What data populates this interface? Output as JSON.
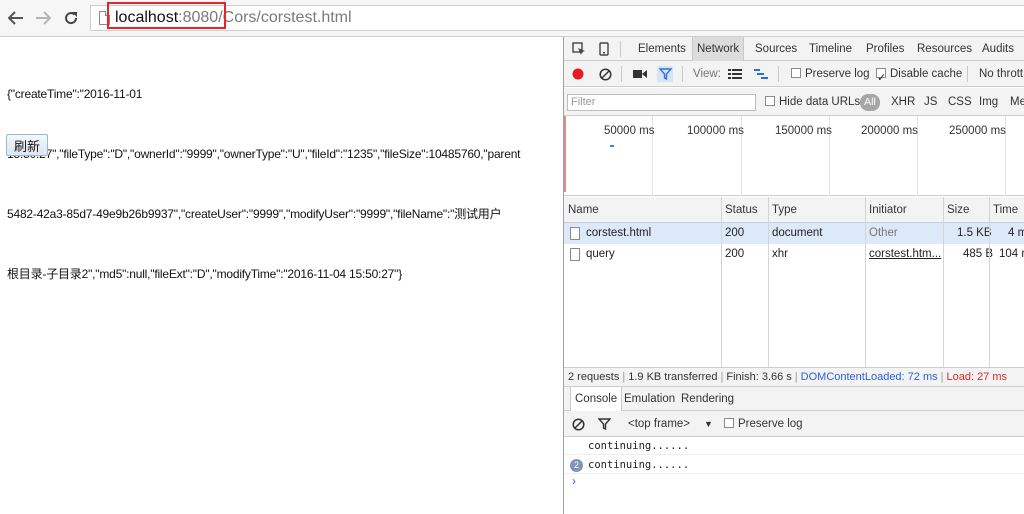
{
  "browser": {
    "url_host": "localhost",
    "url_port": ":8080",
    "url_path": "/Cors/corstest.html",
    "icons": [
      "back-arrow-icon",
      "forward-arrow-icon",
      "reload-icon",
      "page-icon"
    ]
  },
  "page": {
    "json_lines": [
      "{\"createTime\":\"2016-11-01",
      "15:50:27\",\"fileType\":\"D\",\"ownerId\":\"9999\",\"ownerType\":\"U\",\"fileId\":\"1235\",\"fileSize\":10485760,\"parent",
      "5482-42a3-85d7-49e9b26b9937\",\"createUser\":\"9999\",\"modifyUser\":\"9999\",\"fileName\":\"测试用户",
      "根目录-子目录2\",\"md5\":null,\"fileExt\":\"D\",\"modifyTime\":\"2016-11-04 15:50:27\"}"
    ],
    "refresh_label": "刷新"
  },
  "devtools": {
    "tabs": [
      "Elements",
      "Network",
      "Sources",
      "Timeline",
      "Profiles",
      "Resources",
      "Audits"
    ],
    "active_tab": "Network",
    "toolbar": {
      "view_label": "View:",
      "preserve_log": "Preserve log",
      "disable_cache": "Disable cache",
      "throttle": "No thrott"
    },
    "filter": {
      "placeholder": "Filter",
      "hide_data_urls": "Hide data URLs",
      "types": [
        "All",
        "XHR",
        "JS",
        "CSS",
        "Img",
        "Me"
      ]
    },
    "timeline_labels": [
      "50000 ms",
      "100000 ms",
      "150000 ms",
      "200000 ms",
      "250000 ms"
    ],
    "columns": [
      "Name",
      "Status",
      "Type",
      "Initiator",
      "Size",
      "Time"
    ],
    "requests": [
      {
        "name": "corstest.html",
        "status": "200",
        "type": "document",
        "initiator": "Other",
        "size": "1.5 KB",
        "time": "4 m"
      },
      {
        "name": "query",
        "status": "200",
        "type": "xhr",
        "initiator": "corstest.htm...",
        "size": "485 B",
        "time": "104 m"
      }
    ],
    "summary": {
      "requests": "2 requests",
      "transferred": "1.9 KB transferred",
      "finish": "Finish: 3.66 s",
      "dom_content_loaded": "DOMContentLoaded: 72 ms",
      "load": "Load: 27 ms"
    },
    "drawer_tabs": [
      "Console",
      "Emulation",
      "Rendering"
    ],
    "console": {
      "frame": "<top frame>",
      "preserve_log": "Preserve log",
      "messages": [
        {
          "text": "continuing......",
          "count": ""
        },
        {
          "text": "continuing......",
          "count": "2"
        }
      ],
      "prompt": "›"
    },
    "colors": {
      "dom_content_loaded": "#2b60d6",
      "load": "#d62b2b",
      "record": "#e51c23",
      "url_highlight": "#e8232a"
    }
  }
}
